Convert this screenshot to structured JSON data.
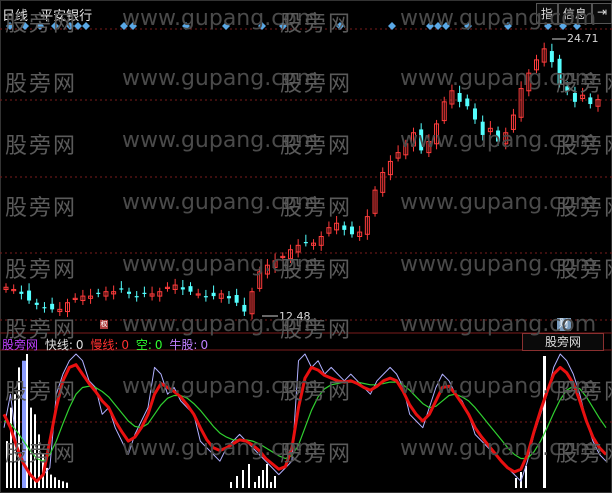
{
  "header": {
    "period_label": "日线",
    "stock_name": "平安银行",
    "buttons": [
      "指",
      "信息",
      "⇥"
    ]
  },
  "price_labels": {
    "high": "24.71",
    "low": "12.48"
  },
  "indicator": {
    "name": "股旁网",
    "fast_label": "快线:",
    "fast_value": "0",
    "slow_label": "慢线:",
    "slow_value": "0",
    "empty_label": "空:",
    "empty_value": "0",
    "bull_label": "牛股:",
    "bull_value": "0",
    "tab_label": "股旁网"
  },
  "markers": {
    "finance": "财",
    "rights": "权"
  },
  "watermarks": {
    "cn": "股旁网",
    "url": "www.gupang.com"
  },
  "colors": {
    "up": "#ff3c3c",
    "down": "#54ffff",
    "grid": "#7a1c1c",
    "fast_line": "#e81010",
    "slow_line": "#30d030",
    "light_line": "#b0b0ff",
    "diamond": "#5aa8e6",
    "name_purple": "#c040ff",
    "fast_white": "#ffffff",
    "slow_red": "#ff3030",
    "empty_green": "#30ff30",
    "bull_purple": "#c080ff"
  },
  "chart_data": {
    "type": "candlestick",
    "y_high": 24.71,
    "y_low": 12.48,
    "closes": [
      13.6,
      13.5,
      13.3,
      13.0,
      12.8,
      12.7,
      12.6,
      12.6,
      12.9,
      13.1,
      13.2,
      13.2,
      13.3,
      13.4,
      13.4,
      13.5,
      13.3,
      13.2,
      13.3,
      13.3,
      13.4,
      13.6,
      13.7,
      13.5,
      13.4,
      13.3,
      13.2,
      13.2,
      13.3,
      13.1,
      12.9,
      12.5,
      13.4,
      14.3,
      14.6,
      14.8,
      15.0,
      15.3,
      15.5,
      15.6,
      15.6,
      15.9,
      16.3,
      16.5,
      16.2,
      16.0,
      16.1,
      16.8,
      18.0,
      18.8,
      19.3,
      19.7,
      20.1,
      20.6,
      19.8,
      20.2,
      21.0,
      22.0,
      22.5,
      22.0,
      21.8,
      21.2,
      20.5,
      20.8,
      20.2,
      20.6,
      21.4,
      22.6,
      23.3,
      23.9,
      24.4,
      23.8,
      22.8,
      22.5,
      22.0,
      22.3,
      21.9,
      22.1
    ],
    "volumes": [
      0.35,
      0.6,
      0.7,
      0.9,
      0.95,
      1.0,
      0.6,
      0.55,
      0.4,
      0.25,
      0.15,
      0.1,
      0.08,
      0.06,
      0.05,
      0.04
    ],
    "indicator_light": [
      0.45,
      0.7,
      0.3,
      0.2,
      0.1,
      0.05,
      0.1,
      0.15,
      0.7,
      0.85,
      0.95,
      1.0,
      0.95,
      0.8,
      0.75,
      0.55,
      0.6,
      0.45,
      0.35,
      0.25,
      0.4,
      0.5,
      0.6,
      0.9,
      0.85,
      0.7,
      0.75,
      0.65,
      0.6,
      0.55,
      0.35,
      0.3,
      0.25,
      0.2,
      0.3,
      0.35,
      0.4,
      0.35,
      0.3,
      0.25,
      0.2,
      0.15,
      0.1,
      0.15,
      0.2,
      0.95,
      1.0,
      0.9,
      0.95,
      0.85,
      0.9,
      0.85,
      0.8,
      0.85,
      0.8,
      0.75,
      0.7,
      0.8,
      0.85,
      0.9,
      0.85,
      0.75,
      0.55,
      0.5,
      0.45,
      0.6,
      0.75,
      0.85,
      0.8,
      0.7,
      0.65,
      0.55,
      0.4,
      0.35,
      0.3,
      0.25,
      0.2,
      0.15,
      0.1,
      0.05,
      0.2,
      0.4,
      0.55,
      0.7,
      0.9,
      1.0,
      0.95,
      0.85,
      0.7,
      0.5,
      0.35,
      0.25,
      0.2
    ],
    "indicator_fast": [
      0.55,
      0.45,
      0.3,
      0.18,
      0.1,
      0.05,
      0.1,
      0.35,
      0.6,
      0.8,
      0.9,
      0.92,
      0.85,
      0.78,
      0.72,
      0.65,
      0.6,
      0.5,
      0.42,
      0.35,
      0.38,
      0.45,
      0.55,
      0.7,
      0.78,
      0.75,
      0.72,
      0.68,
      0.62,
      0.55,
      0.45,
      0.36,
      0.3,
      0.28,
      0.3,
      0.33,
      0.36,
      0.35,
      0.32,
      0.28,
      0.22,
      0.18,
      0.14,
      0.16,
      0.3,
      0.6,
      0.82,
      0.9,
      0.88,
      0.84,
      0.82,
      0.8,
      0.79,
      0.8,
      0.78,
      0.75,
      0.73,
      0.76,
      0.8,
      0.82,
      0.8,
      0.72,
      0.62,
      0.55,
      0.5,
      0.55,
      0.65,
      0.75,
      0.76,
      0.7,
      0.63,
      0.55,
      0.45,
      0.38,
      0.32,
      0.26,
      0.2,
      0.15,
      0.12,
      0.14,
      0.25,
      0.42,
      0.58,
      0.72,
      0.85,
      0.9,
      0.86,
      0.78,
      0.65,
      0.5,
      0.38,
      0.3,
      0.25
    ],
    "indicator_slow": [
      0.5,
      0.48,
      0.42,
      0.35,
      0.28,
      0.22,
      0.2,
      0.25,
      0.35,
      0.48,
      0.6,
      0.7,
      0.75,
      0.76,
      0.75,
      0.72,
      0.68,
      0.62,
      0.56,
      0.5,
      0.46,
      0.45,
      0.48,
      0.55,
      0.62,
      0.67,
      0.69,
      0.69,
      0.67,
      0.63,
      0.58,
      0.52,
      0.46,
      0.41,
      0.38,
      0.36,
      0.36,
      0.36,
      0.35,
      0.33,
      0.3,
      0.27,
      0.24,
      0.22,
      0.24,
      0.32,
      0.45,
      0.58,
      0.68,
      0.74,
      0.77,
      0.78,
      0.79,
      0.79,
      0.79,
      0.78,
      0.77,
      0.77,
      0.78,
      0.79,
      0.79,
      0.77,
      0.73,
      0.68,
      0.63,
      0.6,
      0.61,
      0.65,
      0.69,
      0.7,
      0.68,
      0.65,
      0.6,
      0.54,
      0.48,
      0.42,
      0.36,
      0.3,
      0.25,
      0.22,
      0.22,
      0.27,
      0.35,
      0.45,
      0.56,
      0.66,
      0.73,
      0.76,
      0.74,
      0.68,
      0.6,
      0.52,
      0.45
    ]
  }
}
